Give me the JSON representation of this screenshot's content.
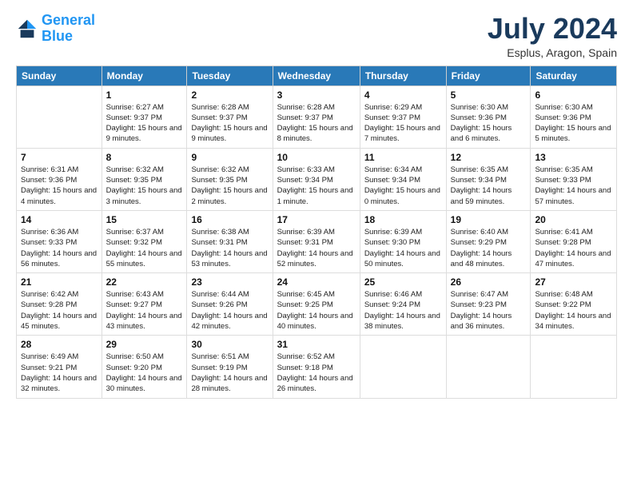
{
  "header": {
    "logo_line1": "General",
    "logo_line2": "Blue",
    "month": "July 2024",
    "location": "Esplus, Aragon, Spain"
  },
  "weekdays": [
    "Sunday",
    "Monday",
    "Tuesday",
    "Wednesday",
    "Thursday",
    "Friday",
    "Saturday"
  ],
  "weeks": [
    [
      null,
      {
        "day": 1,
        "sunrise": "6:27 AM",
        "sunset": "9:37 PM",
        "daylight": "15 hours and 9 minutes."
      },
      {
        "day": 2,
        "sunrise": "6:28 AM",
        "sunset": "9:37 PM",
        "daylight": "15 hours and 9 minutes."
      },
      {
        "day": 3,
        "sunrise": "6:28 AM",
        "sunset": "9:37 PM",
        "daylight": "15 hours and 8 minutes."
      },
      {
        "day": 4,
        "sunrise": "6:29 AM",
        "sunset": "9:37 PM",
        "daylight": "15 hours and 7 minutes."
      },
      {
        "day": 5,
        "sunrise": "6:30 AM",
        "sunset": "9:36 PM",
        "daylight": "15 hours and 6 minutes."
      },
      {
        "day": 6,
        "sunrise": "6:30 AM",
        "sunset": "9:36 PM",
        "daylight": "15 hours and 5 minutes."
      }
    ],
    [
      {
        "day": 7,
        "sunrise": "6:31 AM",
        "sunset": "9:36 PM",
        "daylight": "15 hours and 4 minutes."
      },
      {
        "day": 8,
        "sunrise": "6:32 AM",
        "sunset": "9:35 PM",
        "daylight": "15 hours and 3 minutes."
      },
      {
        "day": 9,
        "sunrise": "6:32 AM",
        "sunset": "9:35 PM",
        "daylight": "15 hours and 2 minutes."
      },
      {
        "day": 10,
        "sunrise": "6:33 AM",
        "sunset": "9:34 PM",
        "daylight": "15 hours and 1 minute."
      },
      {
        "day": 11,
        "sunrise": "6:34 AM",
        "sunset": "9:34 PM",
        "daylight": "15 hours and 0 minutes."
      },
      {
        "day": 12,
        "sunrise": "6:35 AM",
        "sunset": "9:34 PM",
        "daylight": "14 hours and 59 minutes."
      },
      {
        "day": 13,
        "sunrise": "6:35 AM",
        "sunset": "9:33 PM",
        "daylight": "14 hours and 57 minutes."
      }
    ],
    [
      {
        "day": 14,
        "sunrise": "6:36 AM",
        "sunset": "9:33 PM",
        "daylight": "14 hours and 56 minutes."
      },
      {
        "day": 15,
        "sunrise": "6:37 AM",
        "sunset": "9:32 PM",
        "daylight": "14 hours and 55 minutes."
      },
      {
        "day": 16,
        "sunrise": "6:38 AM",
        "sunset": "9:31 PM",
        "daylight": "14 hours and 53 minutes."
      },
      {
        "day": 17,
        "sunrise": "6:39 AM",
        "sunset": "9:31 PM",
        "daylight": "14 hours and 52 minutes."
      },
      {
        "day": 18,
        "sunrise": "6:39 AM",
        "sunset": "9:30 PM",
        "daylight": "14 hours and 50 minutes."
      },
      {
        "day": 19,
        "sunrise": "6:40 AM",
        "sunset": "9:29 PM",
        "daylight": "14 hours and 48 minutes."
      },
      {
        "day": 20,
        "sunrise": "6:41 AM",
        "sunset": "9:28 PM",
        "daylight": "14 hours and 47 minutes."
      }
    ],
    [
      {
        "day": 21,
        "sunrise": "6:42 AM",
        "sunset": "9:28 PM",
        "daylight": "14 hours and 45 minutes."
      },
      {
        "day": 22,
        "sunrise": "6:43 AM",
        "sunset": "9:27 PM",
        "daylight": "14 hours and 43 minutes."
      },
      {
        "day": 23,
        "sunrise": "6:44 AM",
        "sunset": "9:26 PM",
        "daylight": "14 hours and 42 minutes."
      },
      {
        "day": 24,
        "sunrise": "6:45 AM",
        "sunset": "9:25 PM",
        "daylight": "14 hours and 40 minutes."
      },
      {
        "day": 25,
        "sunrise": "6:46 AM",
        "sunset": "9:24 PM",
        "daylight": "14 hours and 38 minutes."
      },
      {
        "day": 26,
        "sunrise": "6:47 AM",
        "sunset": "9:23 PM",
        "daylight": "14 hours and 36 minutes."
      },
      {
        "day": 27,
        "sunrise": "6:48 AM",
        "sunset": "9:22 PM",
        "daylight": "14 hours and 34 minutes."
      }
    ],
    [
      {
        "day": 28,
        "sunrise": "6:49 AM",
        "sunset": "9:21 PM",
        "daylight": "14 hours and 32 minutes."
      },
      {
        "day": 29,
        "sunrise": "6:50 AM",
        "sunset": "9:20 PM",
        "daylight": "14 hours and 30 minutes."
      },
      {
        "day": 30,
        "sunrise": "6:51 AM",
        "sunset": "9:19 PM",
        "daylight": "14 hours and 28 minutes."
      },
      {
        "day": 31,
        "sunrise": "6:52 AM",
        "sunset": "9:18 PM",
        "daylight": "14 hours and 26 minutes."
      },
      null,
      null,
      null
    ]
  ]
}
